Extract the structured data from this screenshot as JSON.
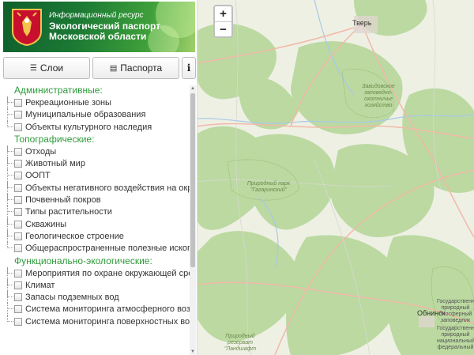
{
  "header": {
    "subtitle": "Информационный ресурс",
    "title_line1": "Экологический паспорт",
    "title_line2": "Московской области"
  },
  "toolbar": {
    "layers_label": "Слои",
    "passports_label": "Паспорта",
    "info_label": "i"
  },
  "tree": {
    "sections": [
      {
        "title": "Административные:",
        "items": [
          "Рекреационные зоны",
          "Муниципальные образования",
          "Объекты культурного наследия"
        ]
      },
      {
        "title": "Топографические:",
        "items": [
          "Отходы",
          "Животный мир",
          "ООПТ",
          "Объекты негативного воздействия на окр",
          "Почвенный покров",
          "Типы растительности",
          "Скважины",
          "Геологическое строение",
          "Общераспространенные полезные ископ"
        ]
      },
      {
        "title": "Функционально-экологические:",
        "items": [
          "Мероприятия по охране окружающей сре",
          "Климат",
          "Запасы подземных вод",
          "Система мониторинга атмосферного возд",
          "Система мониторинга поверхностных вод"
        ]
      }
    ]
  },
  "map": {
    "zoom_in": "+",
    "zoom_out": "−",
    "labels": {
      "tver": "Тверь",
      "zavidovo": "Завидовское заповедно-охотничье хозяйство",
      "gagarinsky": "Природный парк \"Гагаринский\"",
      "obninsk": "Обнинск",
      "reserve_landshaft": "Природный резерват \"Ландшафт",
      "gos_reserve": "Государственный природный биосферный заповедник",
      "gos_park": "Государственный природный национальный федеральный"
    },
    "colors": {
      "land": "#eef0e4",
      "forest": "#b9d89e",
      "road": "#f2b8a8",
      "water": "#a9c9e6"
    }
  }
}
